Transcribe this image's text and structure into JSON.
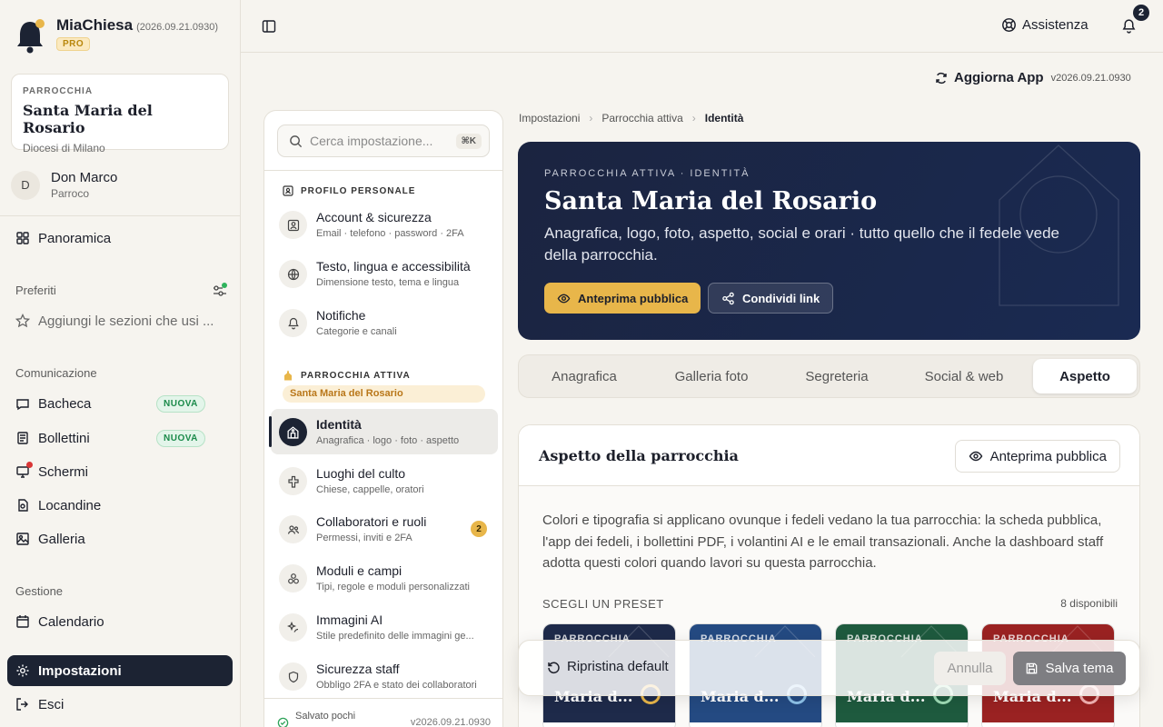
{
  "app": {
    "name": "MiaChiesa",
    "version": "(2026.09.21.0930)",
    "plan": "PRO"
  },
  "parish_card": {
    "label": "PARROCCHIA",
    "name": "Santa Maria del Rosario",
    "diocese": "Diocesi di Milano"
  },
  "user": {
    "initial": "D",
    "name": "Don Marco",
    "role": "Parroco"
  },
  "sidebar": {
    "overview": "Panoramica",
    "favorites_title": "Preferiti",
    "favorites_hint": "Aggiungi le sezioni che usi ...",
    "comm_title": "Comunicazione",
    "comm_items": [
      {
        "label": "Bacheca",
        "badge": "NUOVA"
      },
      {
        "label": "Bollettini",
        "badge": "NUOVA"
      },
      {
        "label": "Schermi"
      },
      {
        "label": "Locandine"
      },
      {
        "label": "Galleria"
      }
    ],
    "mgmt_title": "Gestione",
    "calendar": "Calendario",
    "settings": "Impostazioni",
    "logout": "Esci"
  },
  "topbar": {
    "help": "Assistenza",
    "notifications": "2",
    "update_label": "Aggiorna App",
    "update_version": "v2026.09.21.0930"
  },
  "settings_panel": {
    "search_placeholder": "Cerca impostazione...",
    "search_kbd": "⌘K",
    "personal_title": "PROFILO PERSONALE",
    "personal_items": [
      {
        "title": "Account & sicurezza",
        "sub": "Email · telefono · password · 2FA"
      },
      {
        "title": "Testo, lingua e accessibilità",
        "sub": "Dimensione testo, tema e lingua"
      },
      {
        "title": "Notifiche",
        "sub": "Categorie e canali"
      }
    ],
    "parish_title": "PARROCCHIA ATTIVA",
    "parish_pill": "Santa Maria del Rosario",
    "parish_items": [
      {
        "title": "Identità",
        "sub": "Anagrafica · logo · foto · aspetto"
      },
      {
        "title": "Luoghi del culto",
        "sub": "Chiese, cappelle, oratori"
      },
      {
        "title": "Collaboratori e ruoli",
        "sub": "Permessi, inviti e 2FA",
        "count": "2"
      },
      {
        "title": "Moduli e campi",
        "sub": "Tipi, regole e moduli personalizzati"
      },
      {
        "title": "Immagini AI",
        "sub": "Stile predefinito delle immagini ge..."
      },
      {
        "title": "Sicurezza staff",
        "sub": "Obbligo 2FA e stato dei collaboratori"
      }
    ],
    "saved_text": "Salvato pochi",
    "saved_version": "v2026.09.21.0930"
  },
  "breadcrumb": [
    "Impostazioni",
    "Parrocchia attiva",
    "Identità"
  ],
  "hero": {
    "eyebrow": "PARROCCHIA ATTIVA · IDENTITÀ",
    "title": "Santa Maria del Rosario",
    "description": "Anagrafica, logo, foto, aspetto, social e orari · tutto quello che il fedele vede della parrocchia.",
    "preview_btn": "Anteprima pubblica",
    "share_btn": "Condividi link"
  },
  "tabs": [
    "Anagrafica",
    "Galleria foto",
    "Segreteria",
    "Social & web",
    "Aspetto"
  ],
  "active_tab": "Aspetto",
  "appearance": {
    "title": "Aspetto della parrocchia",
    "preview_btn": "Anteprima pubblica",
    "description": "Colori e tipografia si applicano ovunque i fedeli vedano la tua parrocchia: la scheda pubblica, l'app dei fedeli, i bollettini PDF, i volantini AI e le email transazionali. Anche la dashboard staff adotta questi colori quando lavori su questa parrocchia.",
    "preset_label": "SCEGLI UN PRESET",
    "preset_count": "8 disponibili",
    "presets": [
      {
        "badge": "PARROCCHIA",
        "name": "Maria d...",
        "color": "#1e2a4a",
        "accent": "#e8b64a"
      },
      {
        "badge": "PARROCCHIA",
        "name": "Maria d...",
        "color": "#244a82",
        "accent": "#8fc3ea"
      },
      {
        "badge": "PARROCCHIA",
        "name": "Maria d...",
        "color": "#1e5a3e",
        "accent": "#9fdcb6"
      },
      {
        "badge": "PARROCCHIA",
        "name": "Maria d...",
        "color": "#9a2222",
        "accent": "#f4b3b3"
      }
    ]
  },
  "actionbar": {
    "reset": "Ripristina default",
    "cancel": "Annulla",
    "save": "Salva tema"
  }
}
